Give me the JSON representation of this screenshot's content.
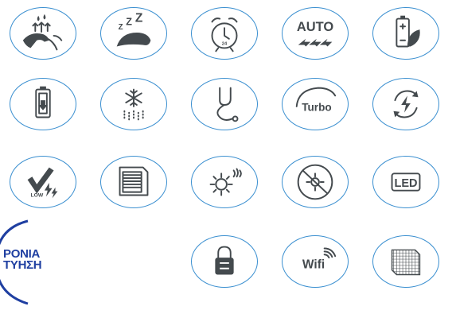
{
  "badges": {
    "auto": {
      "label": "AUTO"
    },
    "timer": {
      "label": "24"
    },
    "turbo": {
      "label": "Turbo"
    },
    "low": {
      "label": "LOW"
    },
    "led": {
      "label": "LED"
    },
    "wifi": {
      "label": "Wifi"
    }
  },
  "logo": {
    "line1": "ΡΟΝΙΑ",
    "line2": "ΤΥΗΣΗ"
  },
  "colors": {
    "border": "#3a8fd0",
    "icon": "#444a4e",
    "logo": "#1f3fa1"
  }
}
